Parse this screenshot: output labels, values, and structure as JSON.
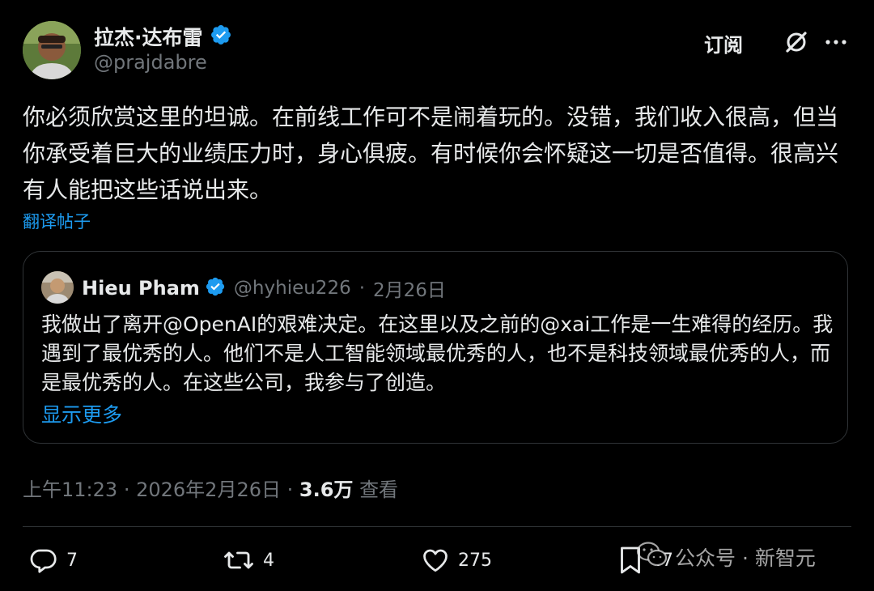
{
  "post": {
    "author_name": "拉杰·达布雷",
    "author_handle": "@prajdabre",
    "subscribe_label": "订阅",
    "text": "你必须欣赏这里的坦诚。在前线工作可不是闹着玩的。没错，我们收入很高，但当你承受着巨大的业绩压力时，身心俱疲。有时候你会怀疑这一切是否值得。很高兴有人能把这些话说出来。",
    "translate_label": "翻译帖子",
    "time": "上午11:23",
    "date": "2026年2月26日",
    "separator": "·",
    "views_count": "3.6万",
    "views_label": "查看"
  },
  "quote": {
    "author_name": "Hieu Pham",
    "author_handle": "@hyhieu226",
    "date": "2月26日",
    "separator": "·",
    "text": "我做出了离开@OpenAI的艰难决定。在这里以及之前的@xai工作是一生难得的经历。我遇到了最优秀的人。他们不是人工智能领域最优秀的人，也不是科技领域最优秀的人，而是最优秀的人。在这些公司，我参与了创造。",
    "show_more_label": "显示更多"
  },
  "actions": {
    "replies": "7",
    "reposts": "4",
    "likes": "275",
    "bookmarks": "47"
  },
  "watermark": {
    "text": "公众号 · 新智元"
  },
  "icons": {
    "verified": "verified-badge-icon",
    "grok": "grok-icon",
    "more": "more-dots-icon",
    "reply": "reply-icon",
    "repost": "repost-icon",
    "like": "heart-icon",
    "bookmark": "bookmark-icon",
    "wechat": "wechat-icon"
  },
  "colors": {
    "background": "#000000",
    "text": "#e7e9ea",
    "muted": "#71767b",
    "link": "#1d9bf0",
    "verified": "#1d9bf0",
    "border": "#2f3336"
  }
}
